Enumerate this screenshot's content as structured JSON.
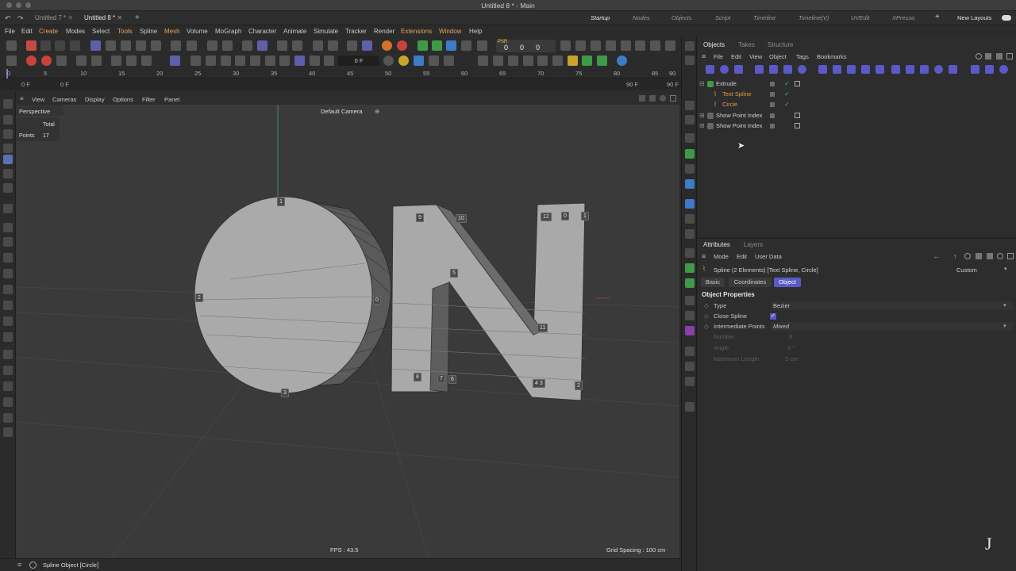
{
  "window": {
    "title": "Untitled 8 * - Main"
  },
  "tabs": [
    {
      "label": "Untitled 7 *"
    },
    {
      "label": "Untitled 8 *"
    }
  ],
  "layouts": [
    "Startup",
    "Nodes",
    "Objects",
    "Script",
    "Timeline",
    "Timeline(V)",
    "UVEdit",
    "XPresso"
  ],
  "new_layouts": "New Layouts",
  "menus": [
    "File",
    "Edit",
    "Create",
    "Modes",
    "Select",
    "Tools",
    "Spline",
    "Mesh",
    "Volume",
    "MoGraph",
    "Character",
    "Animate",
    "Simulate",
    "Tracker",
    "Render",
    "Extensions",
    "Window",
    "Help"
  ],
  "timeline": {
    "ticks": [
      "0",
      "5",
      "10",
      "15",
      "20",
      "25",
      "30",
      "35",
      "40",
      "45",
      "50",
      "55",
      "60",
      "65",
      "70",
      "75",
      "80",
      "85",
      "90"
    ],
    "start": "0 F",
    "current": "0 F",
    "frame_field": "0 F",
    "end1": "90 F",
    "end2": "90 F"
  },
  "psr": {
    "p": "PSR",
    "v": "0",
    "v2": "0",
    "v3": "0"
  },
  "viewport": {
    "menus": [
      "View",
      "Cameras",
      "Display",
      "Options",
      "Filter",
      "Panel"
    ],
    "mode": "Perspective",
    "camera": "Default Camera",
    "hud": {
      "total_label": "Total",
      "points_label": "Points",
      "points_value": "17"
    },
    "fps": "FPS : 43.5",
    "grid": "Grid Spacing : 100 cm",
    "point_labels": [
      "1",
      "2",
      "0",
      "3",
      "9",
      "10",
      "5",
      "12",
      "0",
      "1",
      "11",
      "8",
      "7",
      "6",
      "4 3",
      "2"
    ]
  },
  "status": {
    "text": "Spline Object [Circle]"
  },
  "objects_panel": {
    "tabs": [
      "Objects",
      "Takes",
      "Structure"
    ],
    "menus": [
      "File",
      "Edit",
      "View",
      "Object",
      "Tags",
      "Bookmarks"
    ],
    "items": [
      {
        "name": "Extrude",
        "color": "#d0d0d0"
      },
      {
        "name": "Text Spline",
        "color": "#e59a3b"
      },
      {
        "name": "Circle",
        "color": "#e59a3b"
      },
      {
        "name": "Show Point Index",
        "color": "#d0d0d0"
      },
      {
        "name": "Show Point Index",
        "color": "#d0d0d0"
      }
    ]
  },
  "attributes": {
    "tabs": [
      "Attributes",
      "Layers"
    ],
    "menus": [
      "Mode",
      "Edit",
      "User Data"
    ],
    "header": "Spline (2 Elements) [Text Spline, Circle]",
    "preset": "Custom",
    "subtabs": [
      "Basic",
      "Coordinates",
      "Object"
    ],
    "section": "Object Properties",
    "props": [
      {
        "label": "Type",
        "value": "Bezier"
      },
      {
        "label": "Close Spline",
        "value": "✓"
      },
      {
        "label": "Intermediate Points",
        "value": "Mixed"
      },
      {
        "label": "Number",
        "value": "8"
      },
      {
        "label": "Angle",
        "value": "5 °"
      },
      {
        "label": "Maximum Length",
        "value": "5 cm"
      }
    ]
  },
  "colors": {
    "accent": "#5e5fa8",
    "orange": "#e59a3b",
    "highlight_tab": "#5b59c5"
  }
}
